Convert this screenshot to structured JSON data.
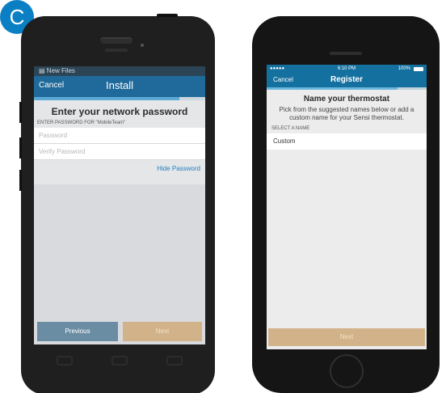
{
  "badge": {
    "letter": "C"
  },
  "android": {
    "notification": "New Files",
    "header": {
      "cancel": "Cancel",
      "title": "Install"
    },
    "progress": 0.85,
    "heading": "Enter your network password",
    "field_label": "ENTER PASSWORD FOR \"MobileTeam\"",
    "password_placeholder": "Password",
    "verify_placeholder": "Verify Password",
    "hide_password": "Hide Password",
    "previous_button": "Previous",
    "next_button": "Next"
  },
  "iphone": {
    "status": {
      "signal": "●●●●●",
      "time": "6:10 PM",
      "battery": "100%"
    },
    "header": {
      "cancel": "Cancel",
      "title": "Register"
    },
    "progress": 0.82,
    "heading": "Name your thermostat",
    "description": "Pick from the suggested names below or add a custom name for your Sensi thermostat.",
    "field_label": "SELECT A NAME",
    "name_value": "Custom",
    "next_button": "Next"
  }
}
